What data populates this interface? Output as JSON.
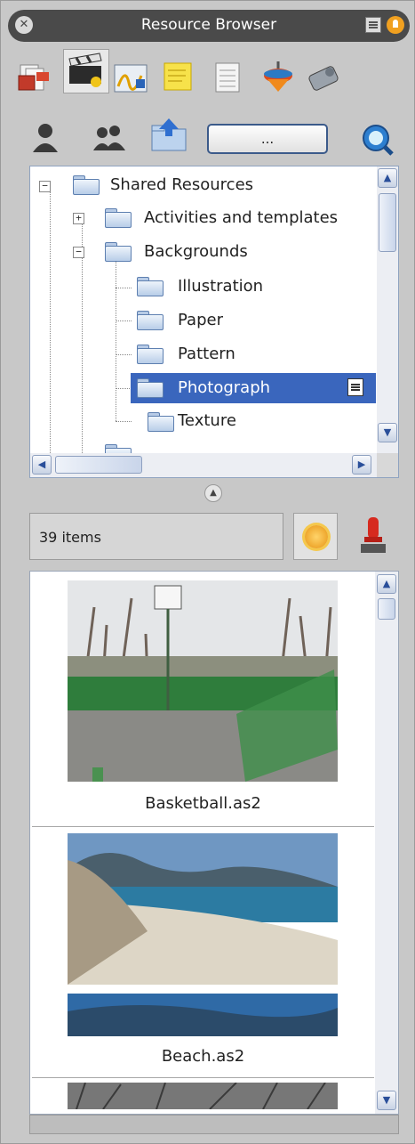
{
  "window": {
    "title": "Resource Browser"
  },
  "tabs": [
    {
      "icon": "pages-icon"
    },
    {
      "icon": "clapperboard-icon",
      "active": true
    },
    {
      "icon": "signature-icon"
    },
    {
      "icon": "sticky-note-icon"
    },
    {
      "icon": "spreadsheet-icon"
    },
    {
      "icon": "spinning-top-icon"
    },
    {
      "icon": "eraser-tool-icon"
    }
  ],
  "toolbar": {
    "browse_label": "..."
  },
  "tree": {
    "nodes": [
      {
        "label": "Shared Resources",
        "expander": "−"
      },
      {
        "label": "Activities and templates",
        "expander": "+"
      },
      {
        "label": "Backgrounds",
        "expander": "−"
      },
      {
        "label": "Illustration"
      },
      {
        "label": "Paper"
      },
      {
        "label": "Pattern"
      },
      {
        "label": "Photograph",
        "selected": true
      },
      {
        "label": "Texture"
      }
    ]
  },
  "status": {
    "count": "39 items"
  },
  "thumbnails": [
    {
      "caption": "Basketball.as2"
    },
    {
      "caption": "Beach.as2"
    }
  ],
  "colors": {
    "selection": "#3a66bd",
    "titlebar": "#4a4a4a",
    "accent": "#2a4f9a"
  }
}
